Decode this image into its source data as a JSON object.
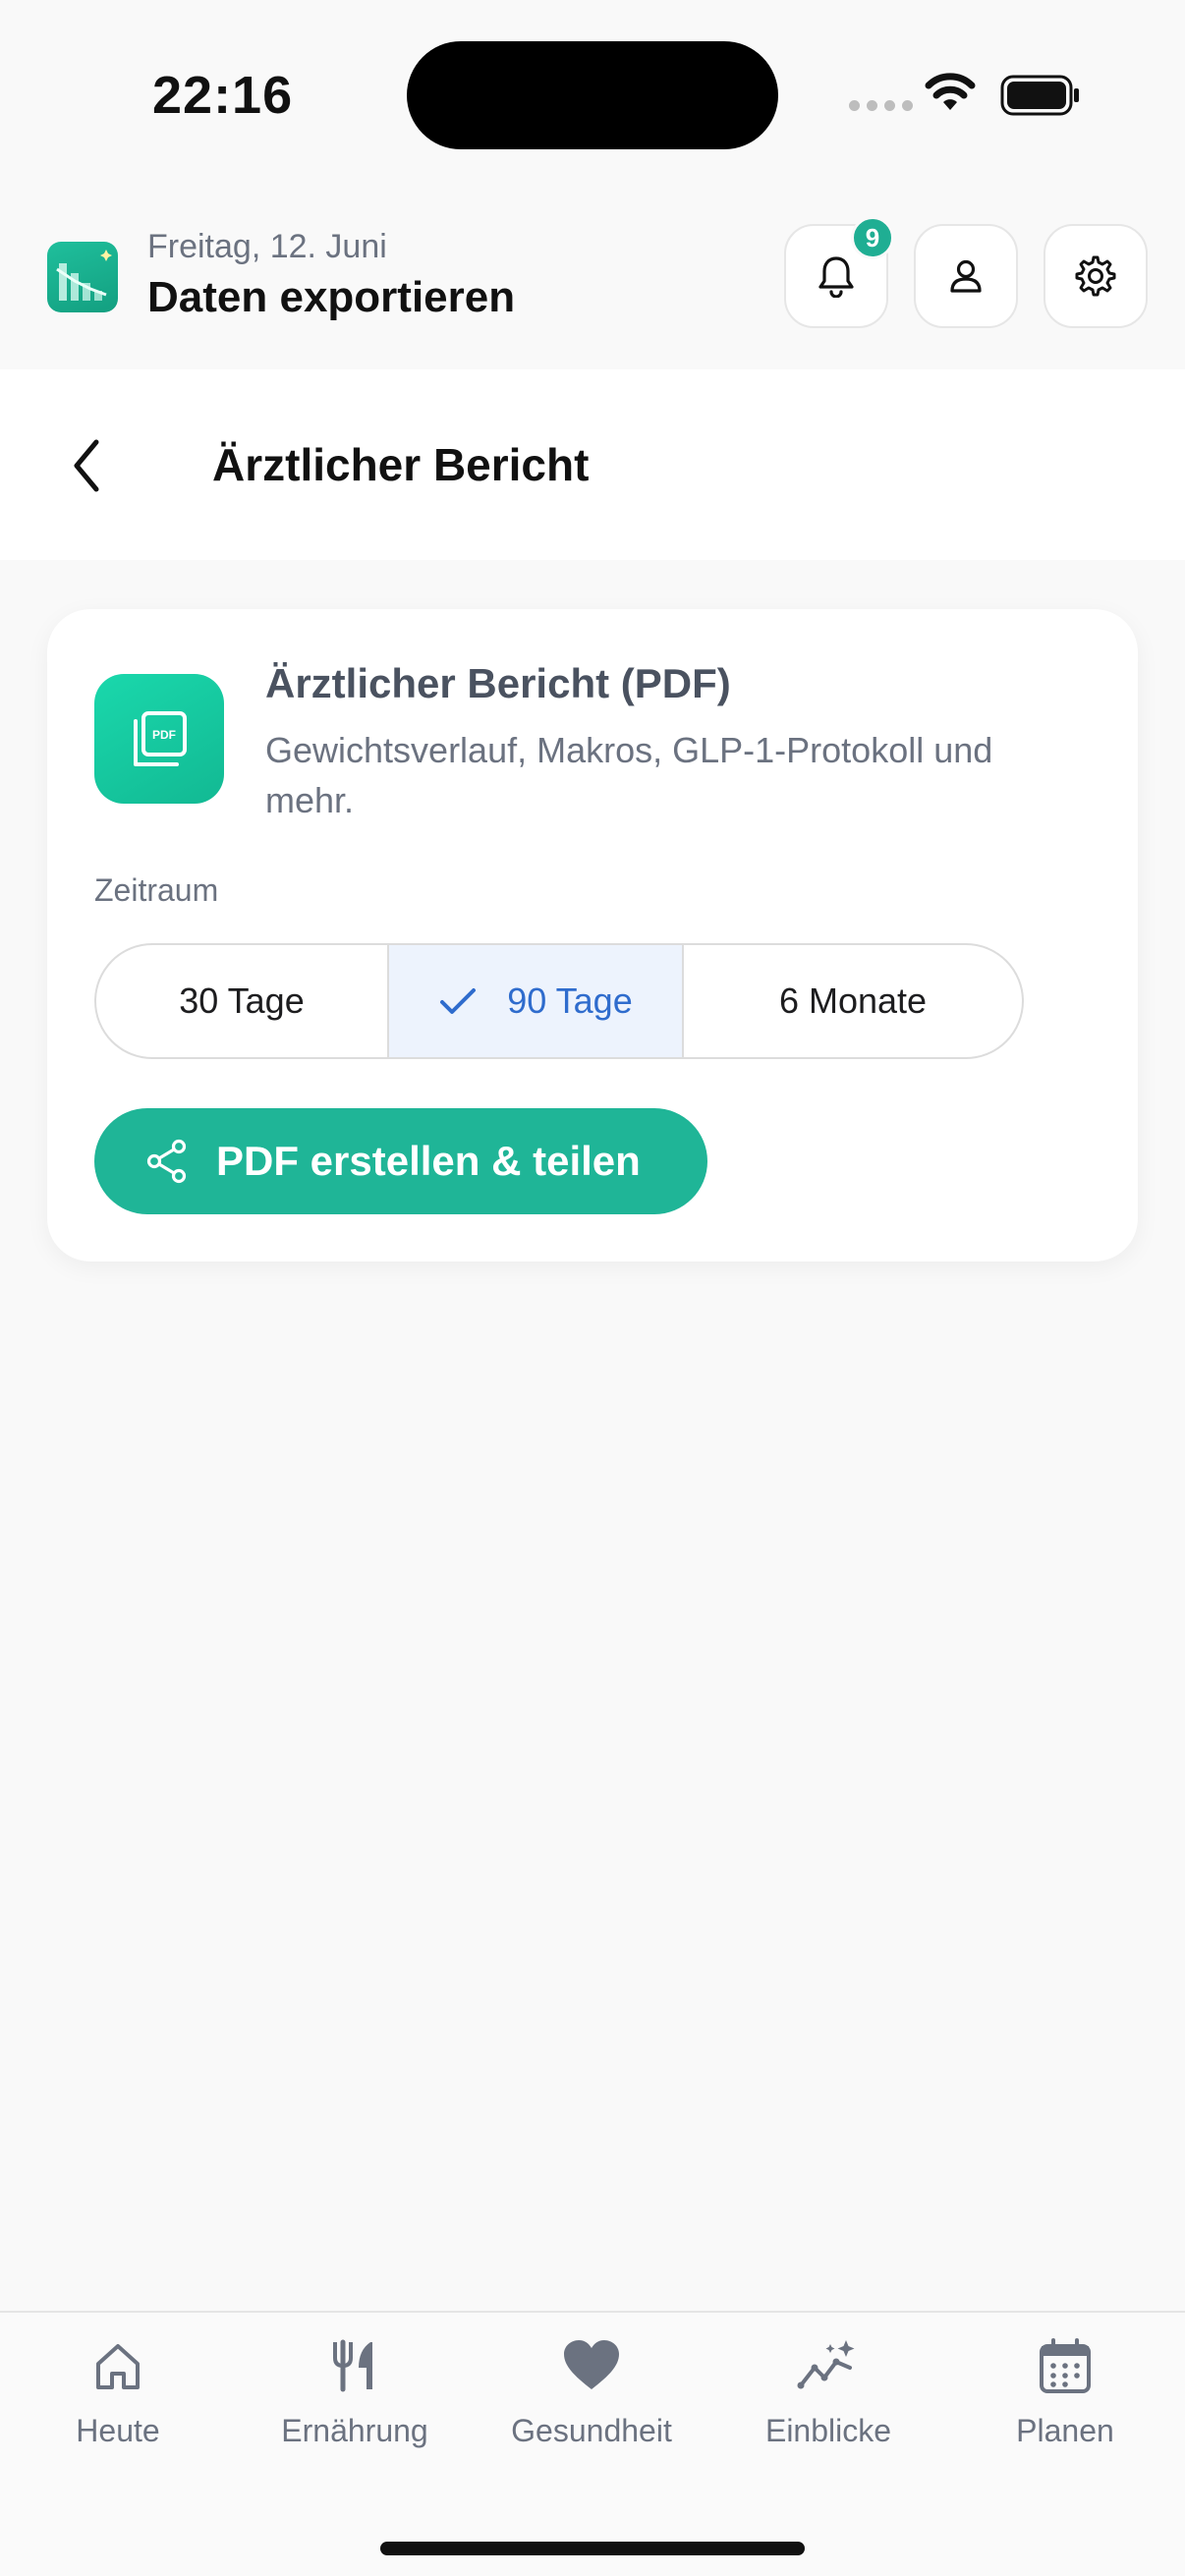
{
  "status_bar": {
    "time": "22:16"
  },
  "header": {
    "date": "Freitag, 12. Juni",
    "title": "Daten exportieren",
    "notification_count": "9",
    "icons": [
      "app-logo",
      "bell-icon",
      "user-icon",
      "gear-icon"
    ]
  },
  "navbar": {
    "title": "Ärztlicher Bericht"
  },
  "card": {
    "title": "Ärztlicher Bericht (PDF)",
    "description": "Gewichtsverlauf, Makros, GLP-1-Protokoll und mehr.",
    "icon_label": "PDF",
    "period_label": "Zeitraum",
    "options": [
      {
        "label": "30 Tage",
        "selected": false
      },
      {
        "label": "90 Tage",
        "selected": true
      },
      {
        "label": "6 Monate",
        "selected": false
      }
    ],
    "button_label": "PDF erstellen & teilen"
  },
  "tabs": [
    {
      "label": "Heute",
      "icon": "home-icon"
    },
    {
      "label": "Ernährung",
      "icon": "fork-knife-icon"
    },
    {
      "label": "Gesundheit",
      "icon": "heart-icon"
    },
    {
      "label": "Einblicke",
      "icon": "sparkle-chart-icon"
    },
    {
      "label": "Planen",
      "icon": "calendar-icon"
    }
  ],
  "colors": {
    "accent": "#1fb597",
    "selected_text": "#2f6ccd",
    "selected_bg": "#edf3fd"
  }
}
